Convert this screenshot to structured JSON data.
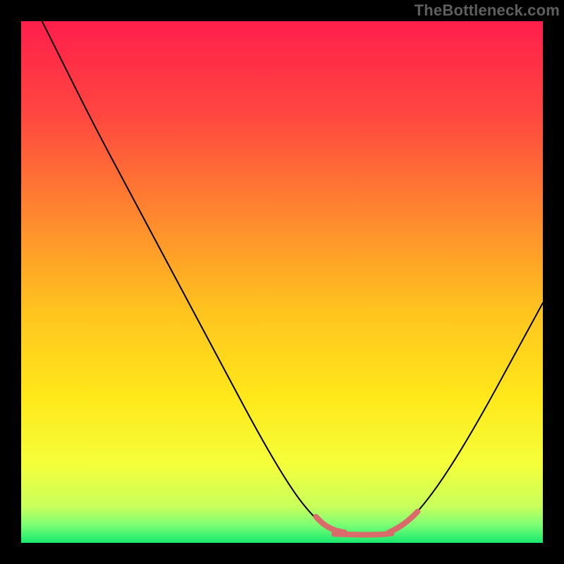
{
  "watermark": "TheBottleneck.com",
  "chart_data": {
    "type": "line",
    "title": "",
    "xlabel": "",
    "ylabel": "",
    "xlim": [
      0,
      100
    ],
    "ylim": [
      0,
      100
    ],
    "grid": false,
    "legend": false,
    "background_gradient_stops": [
      {
        "offset": 0.0,
        "color": "#ff1e4b"
      },
      {
        "offset": 0.18,
        "color": "#ff4740"
      },
      {
        "offset": 0.38,
        "color": "#ff8a2e"
      },
      {
        "offset": 0.55,
        "color": "#ffc21f"
      },
      {
        "offset": 0.72,
        "color": "#ffe81a"
      },
      {
        "offset": 0.85,
        "color": "#f4ff3a"
      },
      {
        "offset": 0.93,
        "color": "#c9ff5b"
      },
      {
        "offset": 0.965,
        "color": "#7dff74"
      },
      {
        "offset": 1.0,
        "color": "#18e86f"
      }
    ],
    "series": [
      {
        "name": "bottleneck-curve",
        "color": "#000000",
        "stroke_width": 2.0,
        "points": [
          {
            "x": 4.0,
            "y": 100.0
          },
          {
            "x": 8.0,
            "y": 92.0
          },
          {
            "x": 14.0,
            "y": 80.0
          },
          {
            "x": 22.0,
            "y": 65.0
          },
          {
            "x": 30.0,
            "y": 50.0
          },
          {
            "x": 38.0,
            "y": 35.0
          },
          {
            "x": 46.0,
            "y": 20.0
          },
          {
            "x": 52.0,
            "y": 10.0
          },
          {
            "x": 56.0,
            "y": 5.0
          },
          {
            "x": 59.0,
            "y": 2.5
          },
          {
            "x": 62.0,
            "y": 1.8
          },
          {
            "x": 66.0,
            "y": 1.6
          },
          {
            "x": 70.0,
            "y": 1.8
          },
          {
            "x": 73.0,
            "y": 3.0
          },
          {
            "x": 77.0,
            "y": 7.0
          },
          {
            "x": 82.0,
            "y": 14.0
          },
          {
            "x": 88.0,
            "y": 24.0
          },
          {
            "x": 94.0,
            "y": 35.0
          },
          {
            "x": 100.0,
            "y": 46.0
          }
        ]
      },
      {
        "name": "optimal-band-left",
        "color": "#d96b6b",
        "stroke_width": 8.0,
        "points": [
          {
            "x": 56.5,
            "y": 5.0
          },
          {
            "x": 58.0,
            "y": 3.5
          },
          {
            "x": 60.0,
            "y": 2.4
          },
          {
            "x": 62.0,
            "y": 2.0
          }
        ]
      },
      {
        "name": "optimal-band-flat",
        "color": "#d96b6b",
        "stroke_width": 8.0,
        "points": [
          {
            "x": 60.0,
            "y": 1.7
          },
          {
            "x": 63.0,
            "y": 1.6
          },
          {
            "x": 66.0,
            "y": 1.55
          },
          {
            "x": 69.0,
            "y": 1.6
          },
          {
            "x": 71.0,
            "y": 1.8
          }
        ]
      },
      {
        "name": "optimal-band-right",
        "color": "#d96b6b",
        "stroke_width": 8.0,
        "points": [
          {
            "x": 70.5,
            "y": 2.0
          },
          {
            "x": 72.5,
            "y": 3.0
          },
          {
            "x": 74.5,
            "y": 4.5
          },
          {
            "x": 76.0,
            "y": 6.0
          }
        ]
      }
    ]
  }
}
